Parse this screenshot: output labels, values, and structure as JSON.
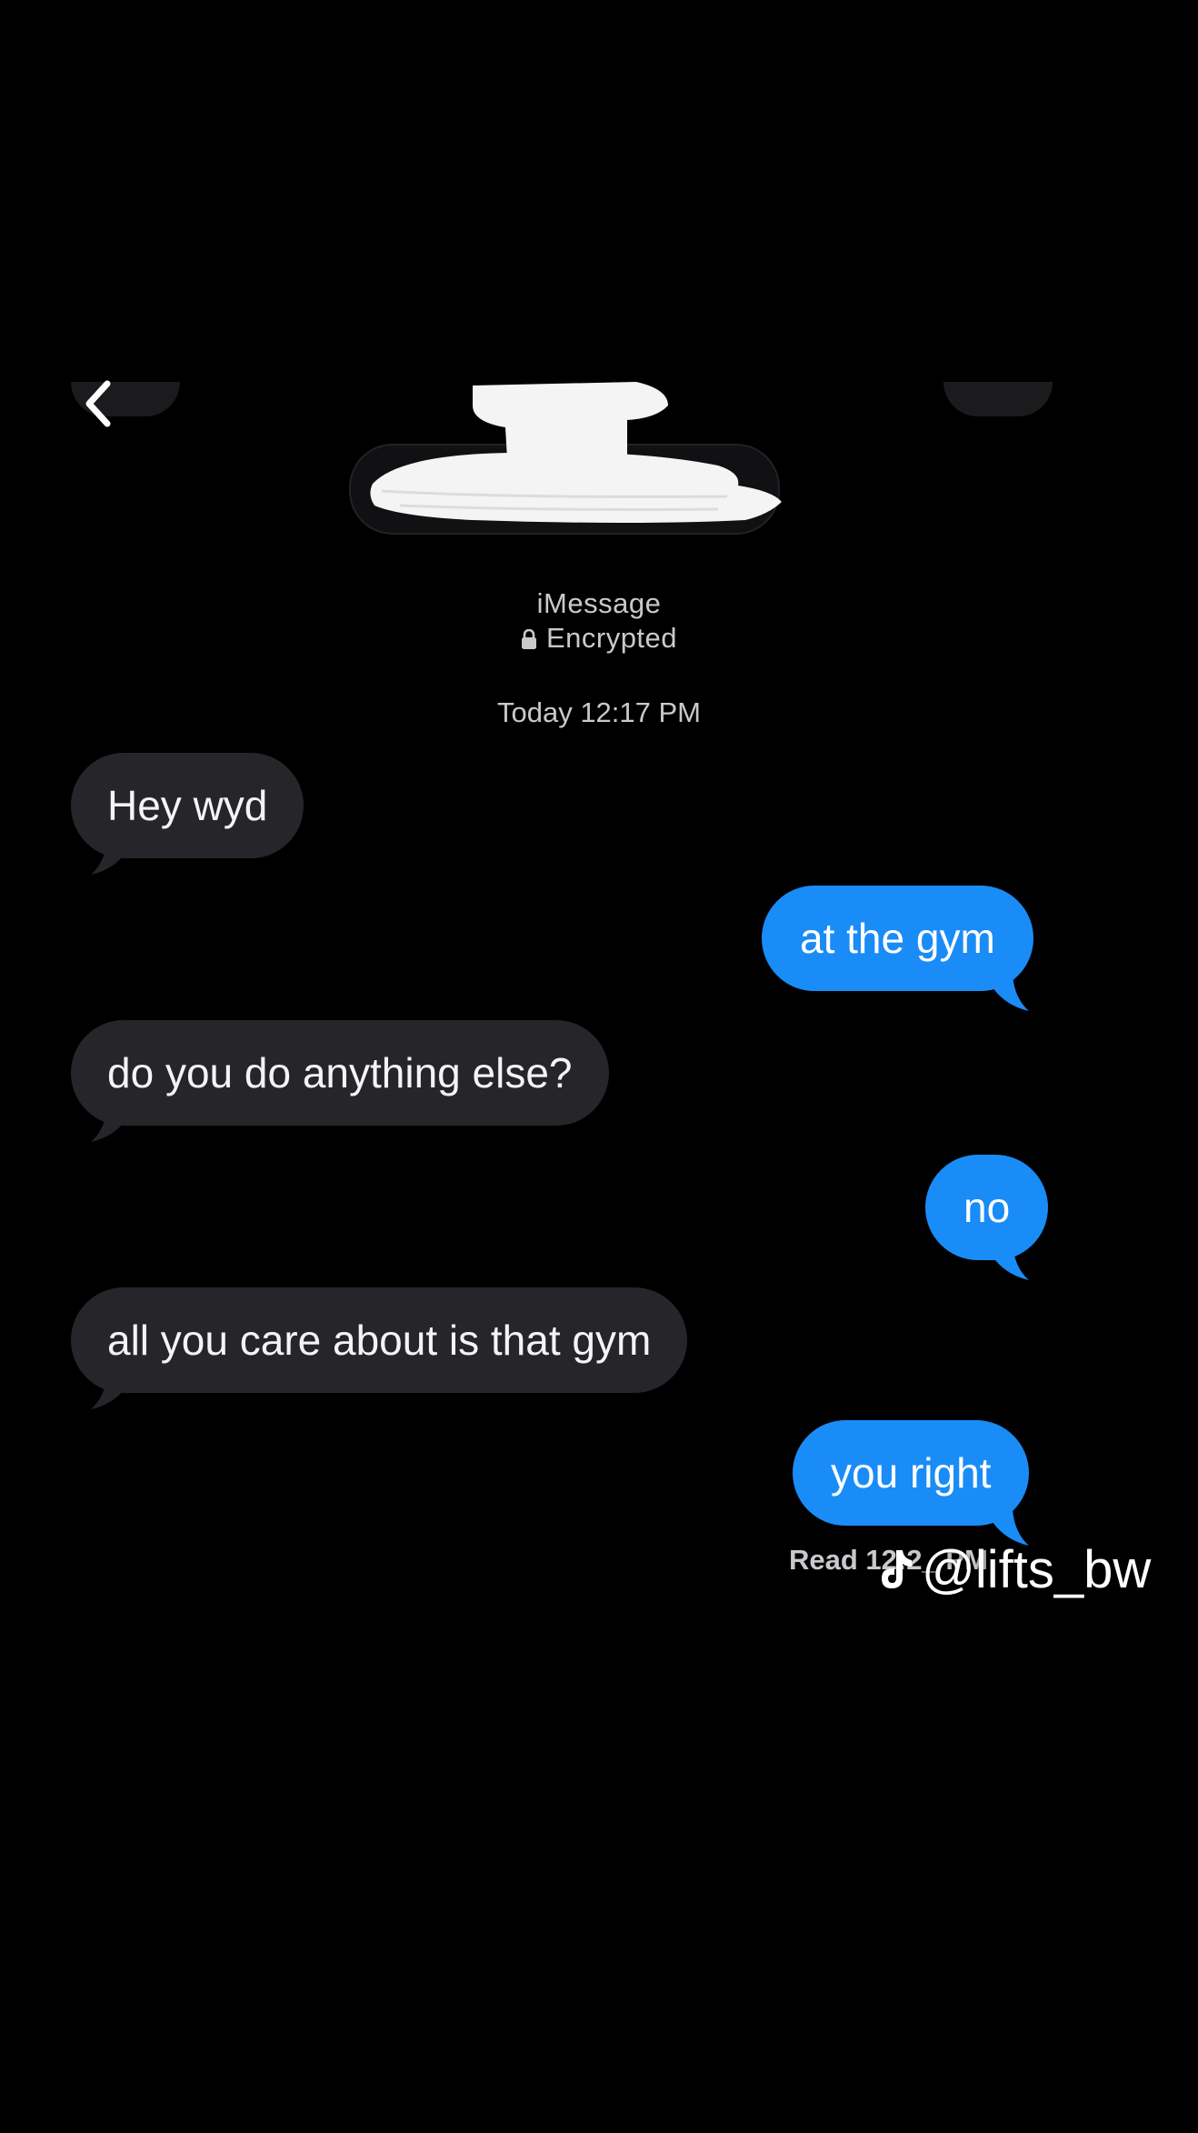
{
  "header": {
    "back_icon": "chevron-left-icon"
  },
  "info": {
    "service": "iMessage",
    "encryption": "Encrypted",
    "lock_icon": "lock-icon",
    "timestamp": "Today 12:17 PM"
  },
  "messages": [
    {
      "direction": "incoming",
      "text": "Hey wyd"
    },
    {
      "direction": "outgoing",
      "text": "at the gym"
    },
    {
      "direction": "incoming",
      "text": "do you do anything else?"
    },
    {
      "direction": "outgoing",
      "text": "no"
    },
    {
      "direction": "incoming",
      "text": "all you care about is that gym"
    },
    {
      "direction": "outgoing",
      "text": "you right"
    }
  ],
  "read_receipt": "Read 12:2_ PM",
  "watermark": {
    "icon": "tiktok-icon",
    "handle": "@lifts_bw"
  },
  "colors": {
    "background": "#000000",
    "incoming_bubble": "#26262a",
    "outgoing_bubble": "#1a8cf7"
  }
}
